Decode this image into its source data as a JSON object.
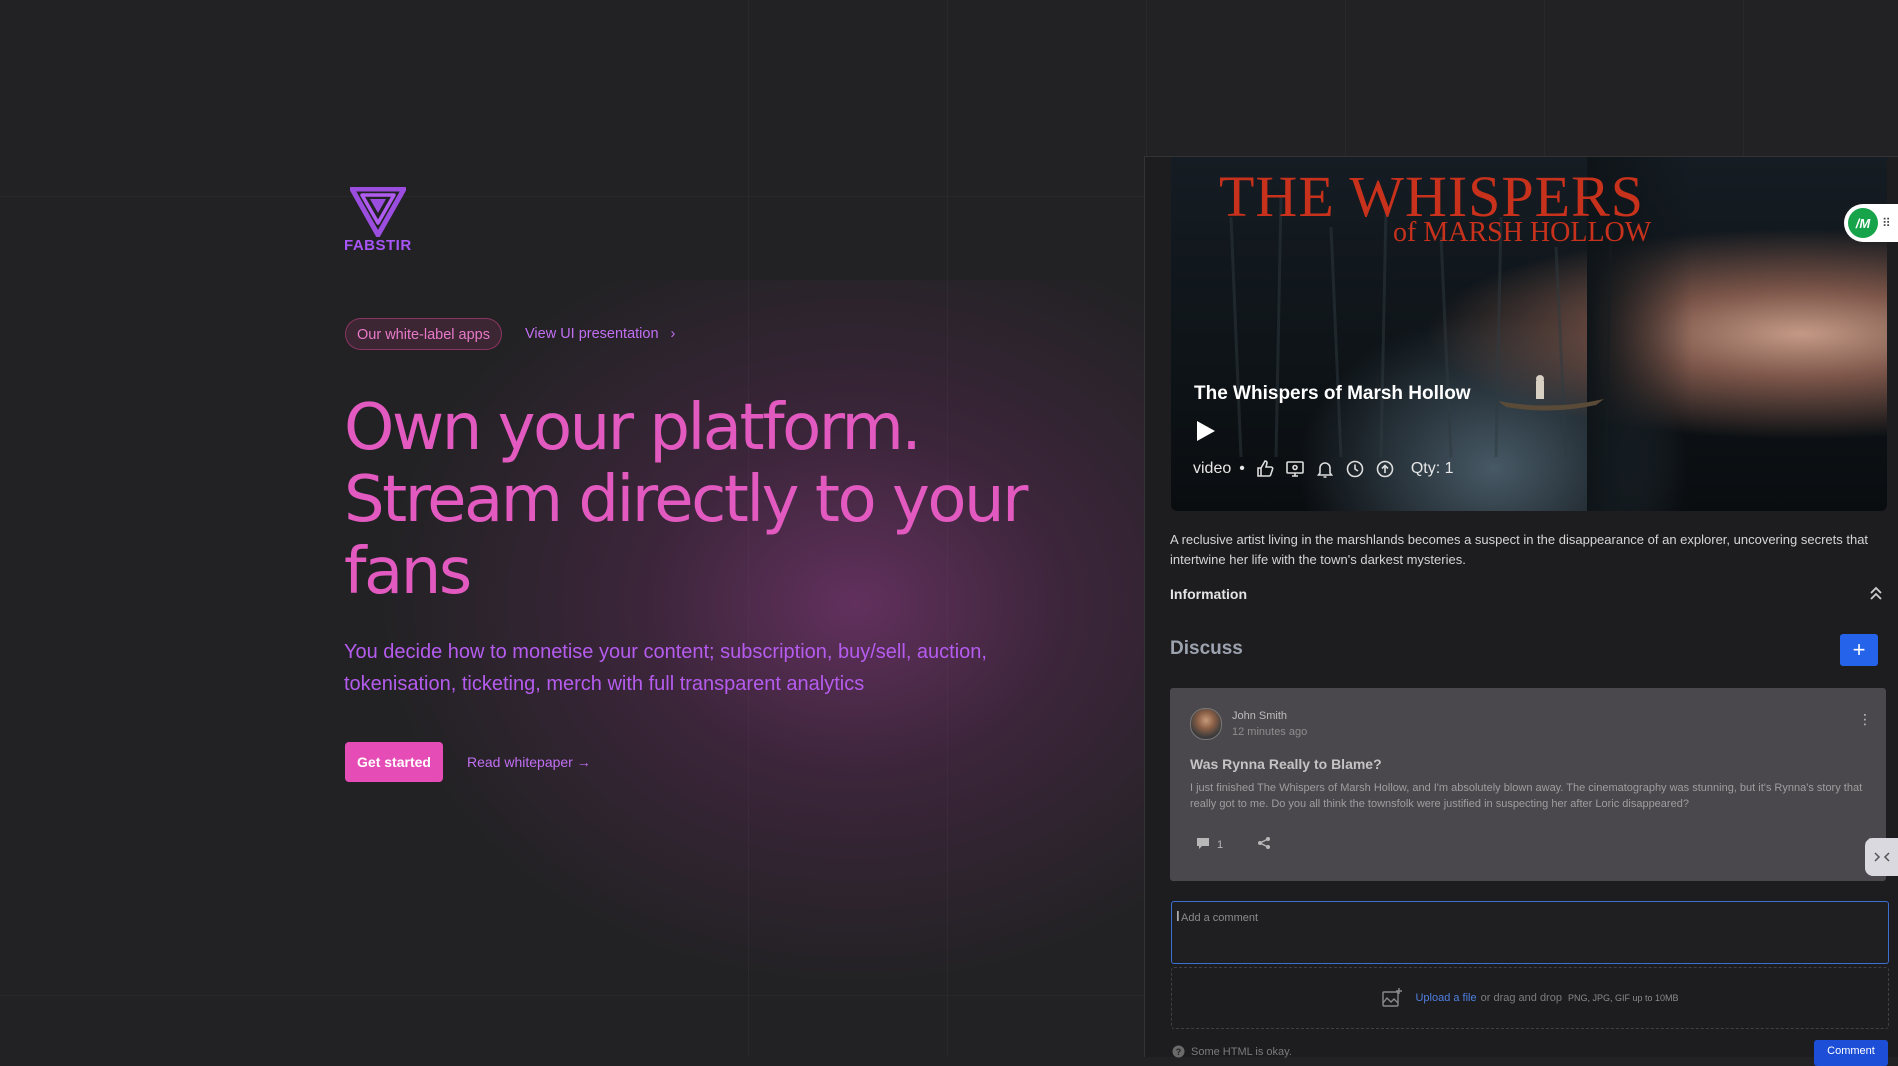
{
  "brand": {
    "name": "FABSTIR",
    "accent": "#a855f7"
  },
  "nav": {
    "pill_label": "Our white-label apps",
    "presentation_link": "View UI presentation"
  },
  "hero": {
    "title": "Own your platform. Stream directly to your fans",
    "subtitle": "You decide how to monetise your content; subscription, buy/sell, auction, tokenisation, ticketing, merch with full transparent analytics",
    "cta_primary": "Get started",
    "cta_secondary": "Read whitepaper →",
    "title_color": "#e25ac0",
    "primary_color": "#e64cb6"
  },
  "media": {
    "poster_title_line1": "THE WHISPERS",
    "poster_title_line2": "of MARSH HOLLOW",
    "title": "The Whispers of Marsh Hollow",
    "type": "video",
    "separator": "•",
    "qty": "Qty: 1",
    "icons": [
      "thumbs-up-icon",
      "screen-cast-icon",
      "bell-icon",
      "clock-icon",
      "arrow-up-circle-icon"
    ],
    "description": "A reclusive artist living in the marshlands becomes a suspect in the disappearance of an explorer, uncovering secrets that intertwine her life with the town's darkest mysteries.",
    "info_label": "Information"
  },
  "extension": {
    "badge_text": "/M"
  },
  "discuss": {
    "heading": "Discuss",
    "add_label": "+",
    "post": {
      "author": "John Smith",
      "time": "12 minutes ago",
      "title": "Was Rynna Really to Blame?",
      "body": "I just finished The Whispers of Marsh Hollow, and I'm absolutely blown away. The cinematography was stunning, but it's Rynna's story that really got to me. Do you all think the townsfolk were justified in suspecting her after Loric disappeared?",
      "comment_count": "1"
    },
    "comment_placeholder": "Add a comment",
    "upload_link": "Upload a file",
    "upload_text": "or drag and drop",
    "upload_types": "PNG, JPG, GIF up to 10MB",
    "html_hint": "Some HTML is okay.",
    "submit_label": "Comment",
    "submit_color": "#1d4ed8"
  }
}
